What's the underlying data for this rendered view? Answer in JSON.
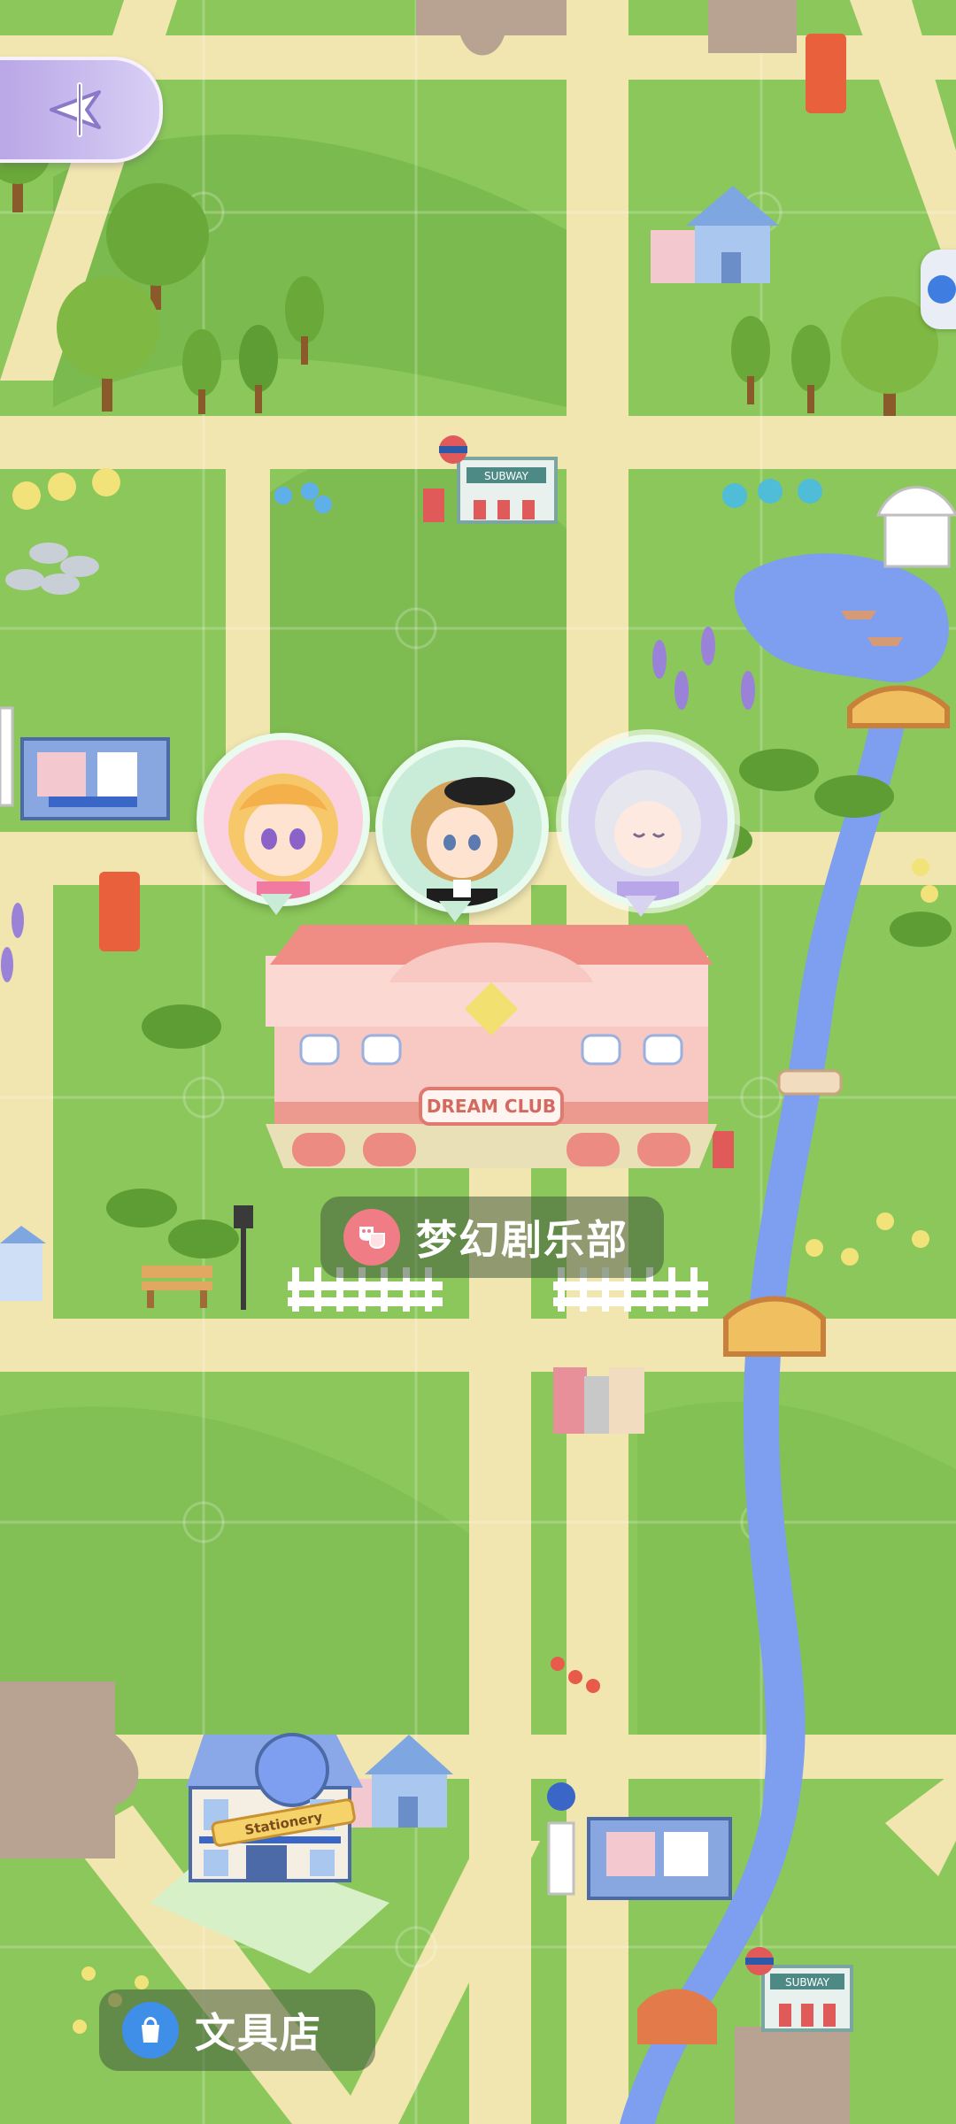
{
  "map": {
    "locations": [
      {
        "name": "梦幻剧乐部",
        "icon": "drama-masks-icon",
        "icon_color": "#f07c86"
      },
      {
        "name": "文具店",
        "icon": "shopping-bag-icon",
        "icon_color": "#3f8ee8"
      }
    ],
    "buildings": {
      "theater_sign": "DREAM CLUB",
      "subway_sign": "SUBWAY",
      "stationery_sign": "Stationery"
    },
    "characters": [
      {
        "name": "blonde-girl-avatar"
      },
      {
        "name": "curly-hair-boy-avatar"
      },
      {
        "name": "white-hair-girl-avatar",
        "highlighted": true
      }
    ]
  },
  "nav": {
    "back_icon": "compass-arrow-icon",
    "side_icon": "notice-icon"
  },
  "colors": {
    "grass": "#8bc75a",
    "road": "#f1e6b0",
    "river": "#7e9ef0",
    "label_bg": "#425a3c"
  }
}
